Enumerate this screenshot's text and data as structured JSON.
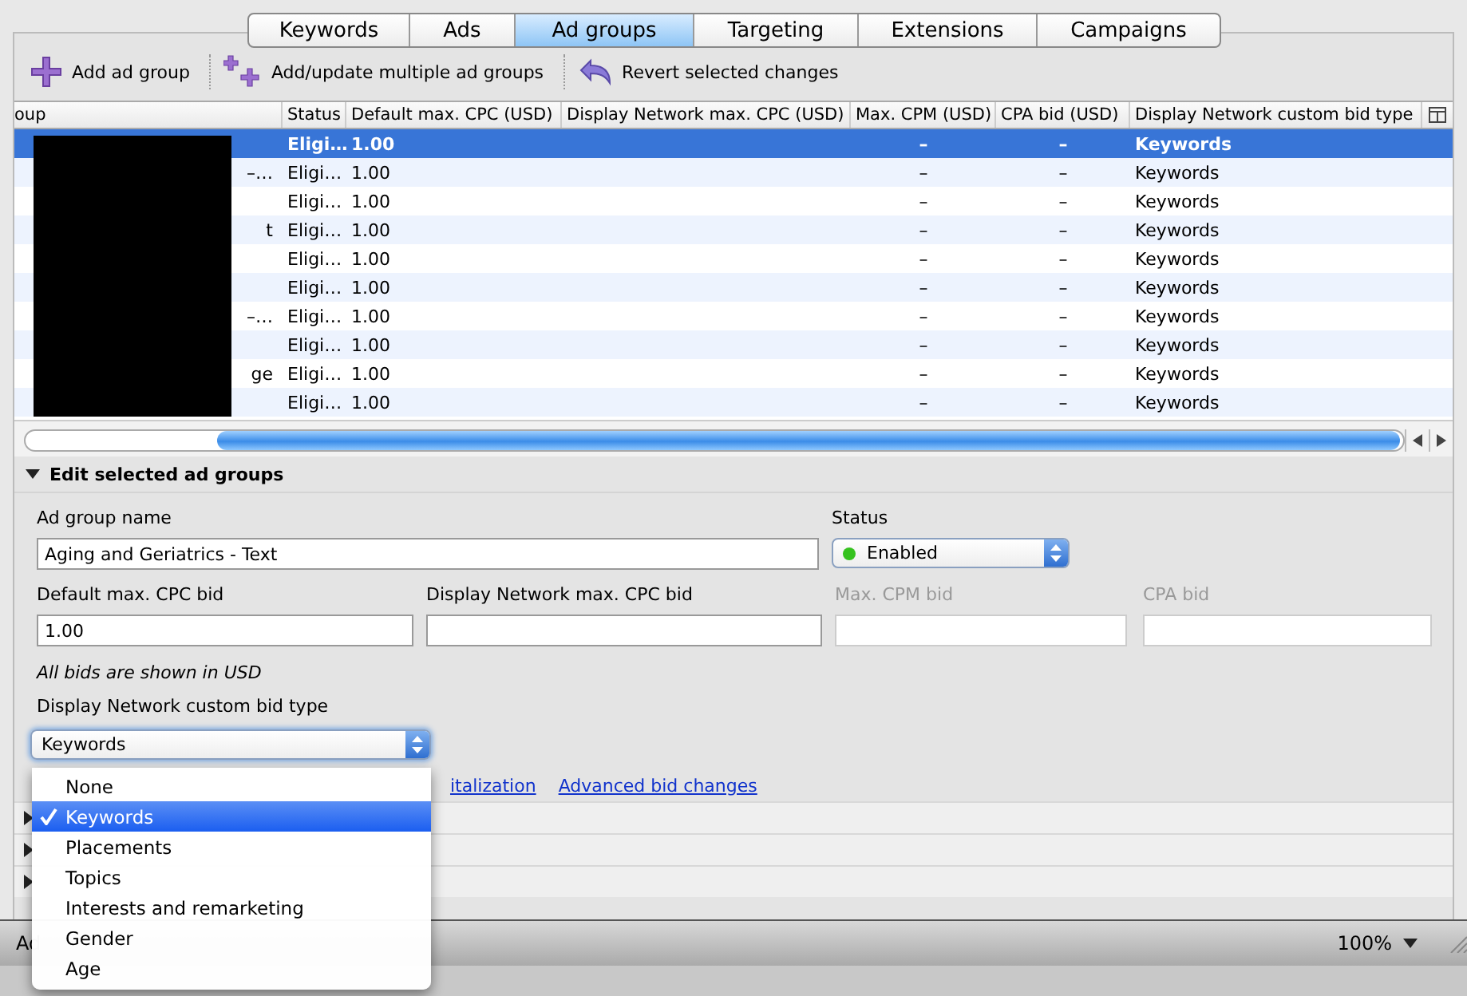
{
  "tabs": [
    {
      "label": "Keywords",
      "selected": false
    },
    {
      "label": "Ads",
      "selected": false
    },
    {
      "label": "Ad groups",
      "selected": true
    },
    {
      "label": "Targeting",
      "selected": false
    },
    {
      "label": "Extensions",
      "selected": false
    },
    {
      "label": "Campaigns",
      "selected": false
    }
  ],
  "toolbar": [
    {
      "kind": "add",
      "label": "Add ad group"
    },
    {
      "kind": "add-multiple",
      "label": "Add/update multiple ad groups"
    },
    {
      "kind": "revert",
      "label": "Revert selected changes"
    }
  ],
  "table": {
    "columns": [
      "oup",
      "Status",
      "Default max. CPC (USD)",
      "Display Network max. CPC (USD)",
      "Max. CPM (USD)",
      "CPA bid (USD)",
      "Display Network custom bid type"
    ],
    "rows": [
      {
        "selected": true,
        "cells": [
          "",
          "Eligi…",
          "1.00",
          "",
          "–",
          "–",
          "Keywords"
        ]
      },
      {
        "selected": false,
        "cells": [
          "–…",
          "Eligi…",
          "1.00",
          "",
          "–",
          "–",
          "Keywords"
        ]
      },
      {
        "selected": false,
        "cells": [
          "",
          "Eligi…",
          "1.00",
          "",
          "–",
          "–",
          "Keywords"
        ]
      },
      {
        "selected": false,
        "cells": [
          "t",
          "Eligi…",
          "1.00",
          "",
          "–",
          "–",
          "Keywords"
        ]
      },
      {
        "selected": false,
        "cells": [
          "",
          "Eligi…",
          "1.00",
          "",
          "–",
          "–",
          "Keywords"
        ]
      },
      {
        "selected": false,
        "cells": [
          "",
          "Eligi…",
          "1.00",
          "",
          "–",
          "–",
          "Keywords"
        ]
      },
      {
        "selected": false,
        "cells": [
          "–…",
          "Eligi…",
          "1.00",
          "",
          "–",
          "–",
          "Keywords"
        ]
      },
      {
        "selected": false,
        "cells": [
          "",
          "Eligi…",
          "1.00",
          "",
          "–",
          "–",
          "Keywords"
        ]
      },
      {
        "selected": false,
        "cells": [
          "ge",
          "Eligi…",
          "1.00",
          "",
          "–",
          "–",
          "Keywords"
        ]
      },
      {
        "selected": false,
        "cells": [
          "",
          "Eligi…",
          "1.00",
          "",
          "–",
          "–",
          "Keywords"
        ]
      }
    ]
  },
  "edit_panel": {
    "title": "Edit selected ad groups",
    "expanded": true,
    "name_field": {
      "label": "Ad group name",
      "value": "Aging and Geriatrics - Text"
    },
    "status_field": {
      "label": "Status",
      "value": "Enabled"
    },
    "bid_fields": [
      {
        "label": "Default max. CPC bid",
        "value": "1.00",
        "disabled": false
      },
      {
        "label": "Display Network max. CPC bid",
        "disabled": false
      },
      {
        "label": "Max. CPM bid",
        "disabled": true
      },
      {
        "label": "CPA bid",
        "disabled": true
      }
    ],
    "note": "All bids are shown in USD",
    "bid_type": {
      "label": "Display Network custom bid type",
      "value": "Keywords"
    },
    "links": [
      "italization",
      "Advanced bid changes"
    ],
    "sections": [
      {
        "expanded": false
      },
      {
        "expanded": false
      },
      {
        "expanded": false
      }
    ]
  },
  "dropdown_menu": [
    {
      "label": "None",
      "selected": false
    },
    {
      "label": "Keywords",
      "selected": true
    },
    {
      "label": "Placements",
      "selected": false
    },
    {
      "label": "Topics",
      "selected": false
    },
    {
      "label": "Interests and remarketing",
      "selected": false
    },
    {
      "label": "Gender",
      "selected": false
    },
    {
      "label": "Age",
      "selected": false
    }
  ],
  "status_bar": {
    "text": "Ad",
    "zoom": "100%"
  }
}
